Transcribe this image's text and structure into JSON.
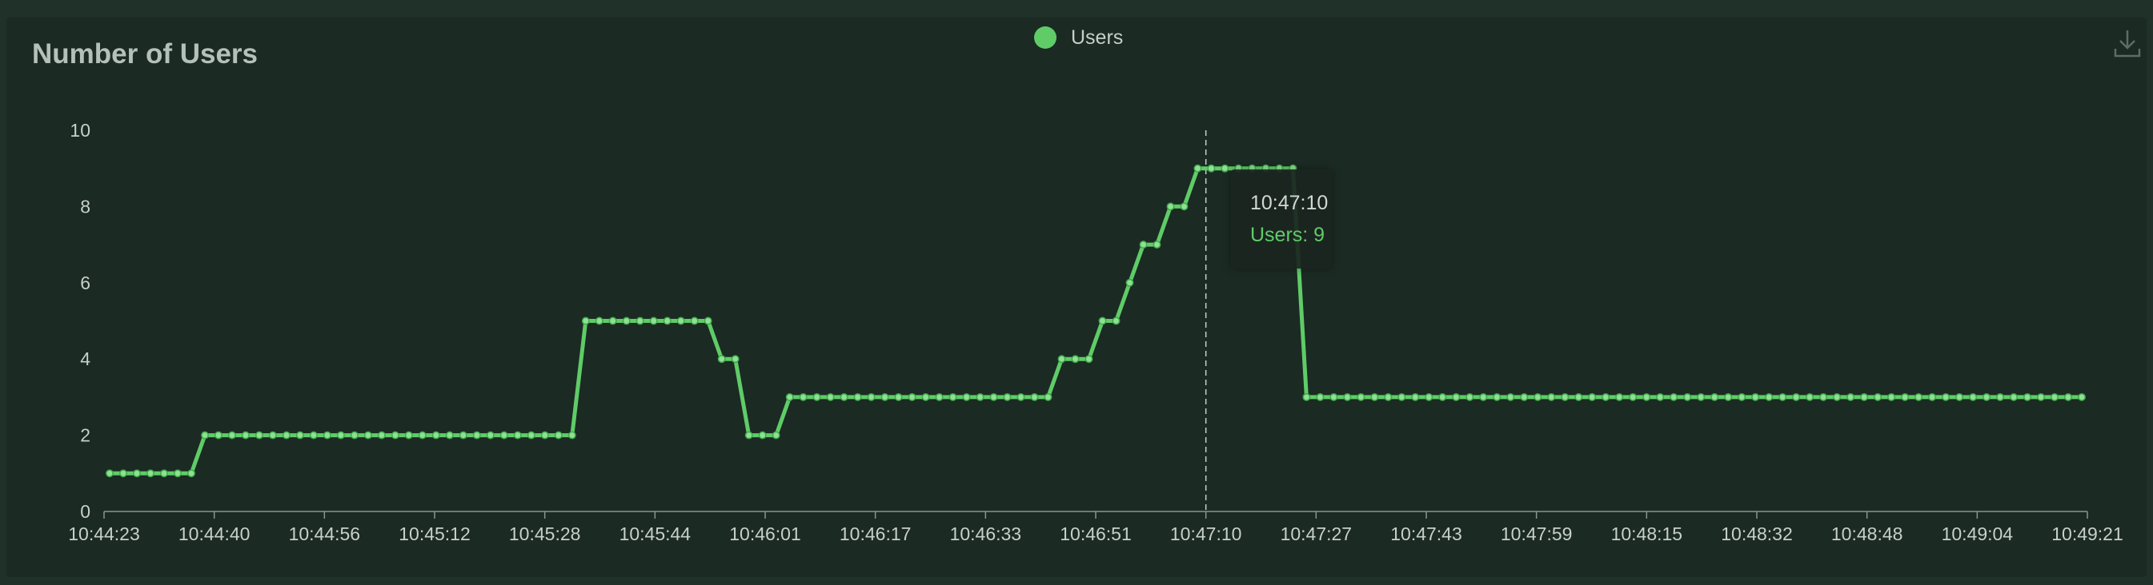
{
  "legend": {
    "label": "Users"
  },
  "colors": {
    "series": "#5fcc67",
    "axis": "#8a9690",
    "text": "#c7d0cb",
    "crosshair": "#c8d0cc"
  },
  "icons": {
    "download": "download-icon"
  },
  "tooltip": {
    "time": "10:47:10",
    "text": "Users: 9"
  },
  "chart_data": {
    "type": "line",
    "title": "Number of Users",
    "xlabel": "",
    "ylabel": "",
    "ylim": [
      0,
      10
    ],
    "yticks": [
      0,
      2,
      4,
      6,
      8,
      10
    ],
    "xtick_labels": [
      "10:44:23",
      "10:44:40",
      "10:44:56",
      "10:45:12",
      "10:45:28",
      "10:45:44",
      "10:46:01",
      "10:46:17",
      "10:46:33",
      "10:46:51",
      "10:47:10",
      "10:47:27",
      "10:47:43",
      "10:47:59",
      "10:48:15",
      "10:48:32",
      "10:48:48",
      "10:49:04",
      "10:49:21"
    ],
    "grid": false,
    "legend_position": "top-center",
    "series": [
      {
        "name": "Users",
        "values": [
          1,
          1,
          1,
          1,
          1,
          1,
          1,
          2,
          2,
          2,
          2,
          2,
          2,
          2,
          2,
          2,
          2,
          2,
          2,
          2,
          2,
          2,
          2,
          2,
          2,
          2,
          2,
          2,
          2,
          2,
          2,
          2,
          2,
          2,
          2,
          5,
          5,
          5,
          5,
          5,
          5,
          5,
          5,
          5,
          5,
          4,
          4,
          2,
          2,
          2,
          3,
          3,
          3,
          3,
          3,
          3,
          3,
          3,
          3,
          3,
          3,
          3,
          3,
          3,
          3,
          3,
          3,
          3,
          3,
          3,
          4,
          4,
          4,
          5,
          5,
          6,
          7,
          7,
          8,
          8,
          9,
          9,
          9,
          9,
          9,
          9,
          9,
          9,
          3,
          3,
          3,
          3,
          3,
          3,
          3,
          3,
          3,
          3,
          3,
          3,
          3,
          3,
          3,
          3,
          3,
          3,
          3,
          3,
          3,
          3,
          3,
          3,
          3,
          3,
          3,
          3,
          3,
          3,
          3,
          3,
          3,
          3,
          3,
          3,
          3,
          3,
          3,
          3,
          3,
          3,
          3,
          3,
          3,
          3,
          3,
          3,
          3,
          3,
          3,
          3,
          3,
          3,
          3,
          3,
          3,
          3
        ]
      }
    ]
  }
}
